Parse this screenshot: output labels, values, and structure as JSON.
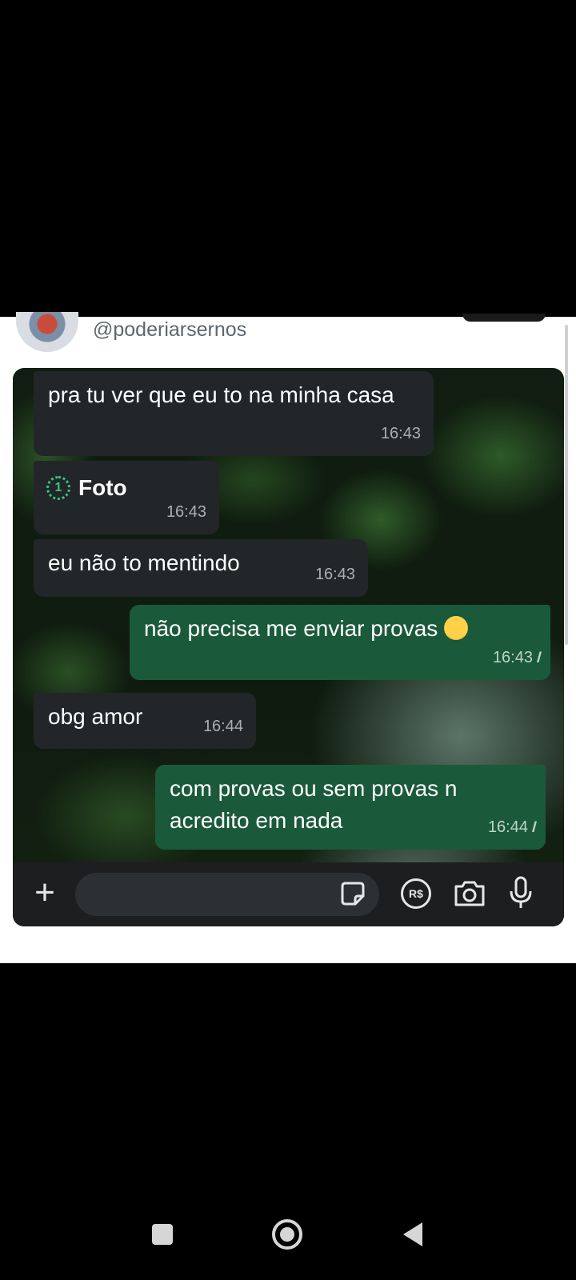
{
  "tweet": {
    "handle": "@poderiarsernos"
  },
  "chat": {
    "messages": [
      {
        "direction": "incoming",
        "text": "pra tu ver que eu to na minha casa",
        "time": "16:43"
      },
      {
        "direction": "incoming",
        "type": "view-once-photo",
        "view_once_label": "1",
        "text": "Foto",
        "time": "16:43"
      },
      {
        "direction": "incoming",
        "text": "eu não to mentindo",
        "time": "16:43"
      },
      {
        "direction": "outgoing",
        "text": "não precisa me enviar provas",
        "emoji": "smiling-face-with-hearts-icon",
        "time": "16:43",
        "status": "delivered"
      },
      {
        "direction": "incoming",
        "text": "obg amor",
        "time": "16:44"
      },
      {
        "direction": "outgoing",
        "text": "com provas ou sem provas n acredito em nada",
        "time": "16:44",
        "status": "delivered"
      }
    ],
    "input_bar": {
      "plus_icon": "plus-icon",
      "placeholder": "",
      "sticker_icon": "sticker-icon",
      "payment_label": "R$",
      "camera_icon": "camera-icon",
      "mic_icon": "microphone-icon"
    },
    "colors": {
      "incoming_bubble": "#232628",
      "outgoing_bubble": "#1a5a3a",
      "view_once_accent": "#35c786"
    }
  },
  "nav": {
    "recents_icon": "recents-icon",
    "home_icon": "home-icon",
    "back_icon": "back-icon"
  }
}
